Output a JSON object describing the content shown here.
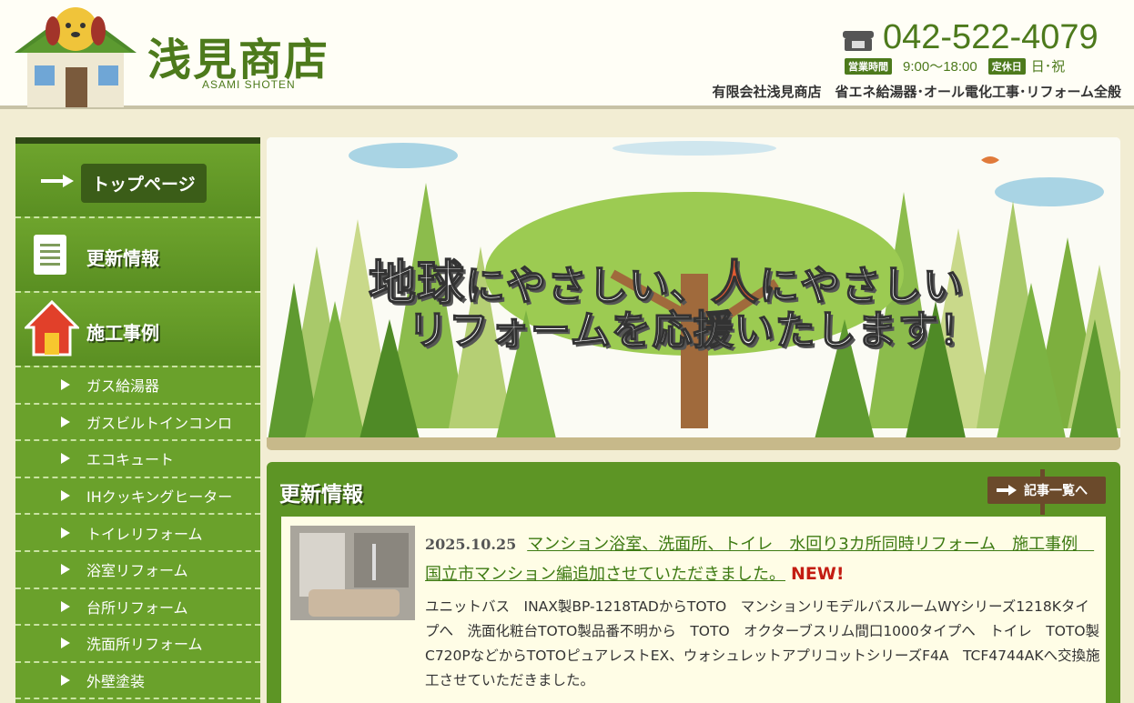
{
  "header": {
    "logo_text": "浅見商店",
    "logo_sub": "ASAMI SHOTEN",
    "tel": "042-522-4079",
    "hours_badge": "営業時間",
    "hours": "9:00～18:00",
    "holiday_badge": "定休日",
    "holiday": "日･祝",
    "company": "有限会社浅見商店　省エネ給湯器･オール電化工事･リフォーム全般"
  },
  "sidebar": {
    "top_page": "トップページ",
    "news": "更新情報",
    "works": "施工事例",
    "items": [
      {
        "label": "ガス給湯器"
      },
      {
        "label": "ガスビルトインコンロ"
      },
      {
        "label": "エコキュート"
      },
      {
        "label": "IHクッキングヒーター"
      },
      {
        "label": "トイレリフォーム"
      },
      {
        "label": "浴室リフォーム"
      },
      {
        "label": "台所リフォーム"
      },
      {
        "label": "洗面所リフォーム"
      },
      {
        "label": "外壁塗装"
      }
    ]
  },
  "hero": {
    "line1_a": "地球",
    "line1_b": "にやさしい、",
    "line1_c": "人",
    "line1_d": "にやさしい",
    "line2": "リフォームを応援いたします！"
  },
  "news": {
    "title": "更新情報",
    "list_button": "記事一覧へ",
    "entry": {
      "date": "2025.10.25",
      "title": "マンション浴室、洗面所、トイレ　水回り3カ所同時リフォーム　施工事例　国立市マンション編追加させていただきました。",
      "new_label": "NEW!",
      "desc": "ユニットバス　INAX製BP-1218TADからTOTO　マンションリモデルバスルームWYシリーズ1218Kタイプへ　洗面化粧台TOTO製品番不明から　TOTO　オクターブスリム間口1000タイプへ　トイレ　TOTO製　C720PなどからTOTOピュアレストEX、ウォシュレットアプリコットシリーズF4A　TCF4744AKへ交換施工させていただきました。"
    }
  },
  "colors": {
    "brand_green": "#4d7a1c",
    "sidebar_green": "#6aa12b",
    "new_red": "#c31d12"
  }
}
